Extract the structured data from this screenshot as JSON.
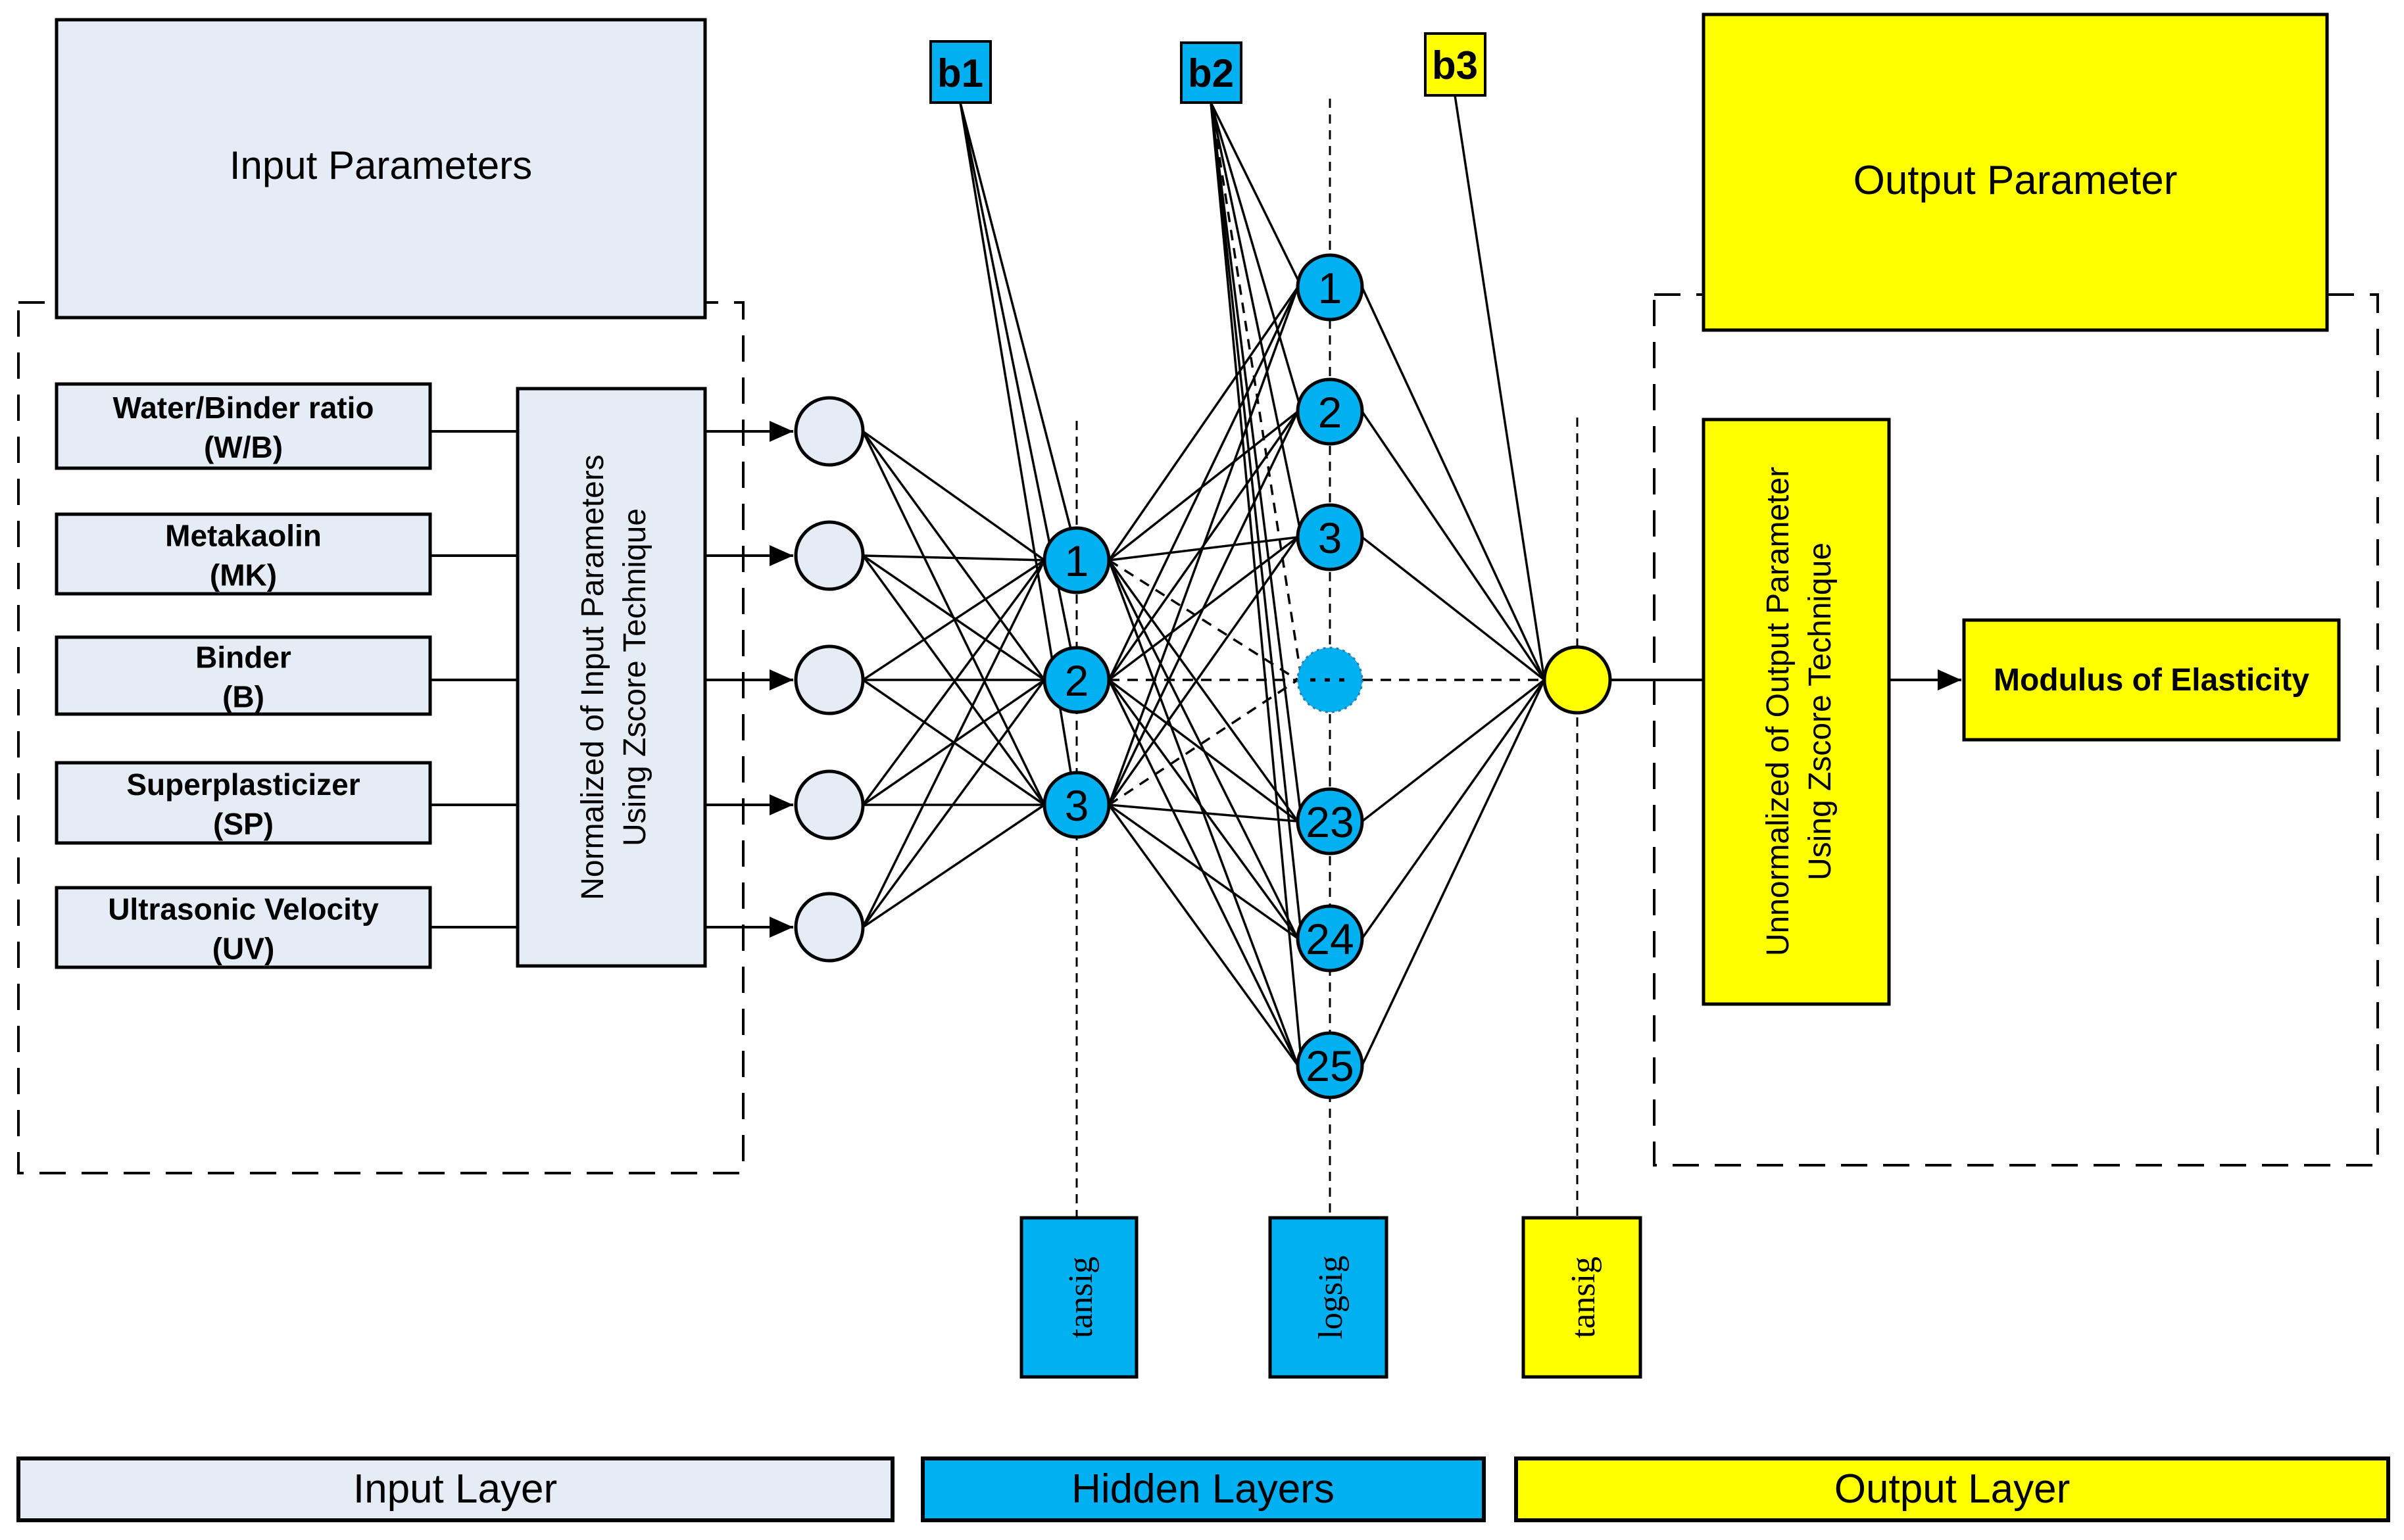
{
  "colors": {
    "input": "#E5ECF6",
    "hidden": "#00B0F0",
    "output": "#FFFF00",
    "stroke": "#000000"
  },
  "input_section": {
    "title": "Input Parameters",
    "parameters": [
      {
        "name": "Water/Binder ratio",
        "abbr": "(W/B)"
      },
      {
        "name": "Metakaolin",
        "abbr": "(MK)"
      },
      {
        "name": "Binder",
        "abbr": "(B)"
      },
      {
        "name": "Superplasticizer",
        "abbr": "(SP)"
      },
      {
        "name": "Ultrasonic Velocity",
        "abbr": "(UV)"
      }
    ],
    "normalization": {
      "line1": "Normalized of Input Parameters",
      "line2": "Using Zscore Technique"
    }
  },
  "network": {
    "input_neurons": 5,
    "hidden_layer_1": {
      "labels": [
        "1",
        "2",
        "3"
      ],
      "bias": "b1",
      "activation": "tansig"
    },
    "hidden_layer_2": {
      "labels": [
        "1",
        "2",
        "3",
        "...",
        "23",
        "24",
        "25"
      ],
      "bias": "b2",
      "activation": "logsig"
    },
    "output_layer": {
      "neurons": 1,
      "bias": "b3",
      "activation": "tansig"
    }
  },
  "output_section": {
    "title": "Output Parameter",
    "unnormalization": {
      "line1": "Unnormalized of Output Parameter",
      "line2": "Using Zscore Technique"
    },
    "result": "Modulus of Elasticity"
  },
  "legend": [
    {
      "label": "Input Layer",
      "color": "#E5ECF6"
    },
    {
      "label": "Hidden Layers",
      "color": "#00B0F0"
    },
    {
      "label": "Output Layer",
      "color": "#FFFF00"
    }
  ]
}
